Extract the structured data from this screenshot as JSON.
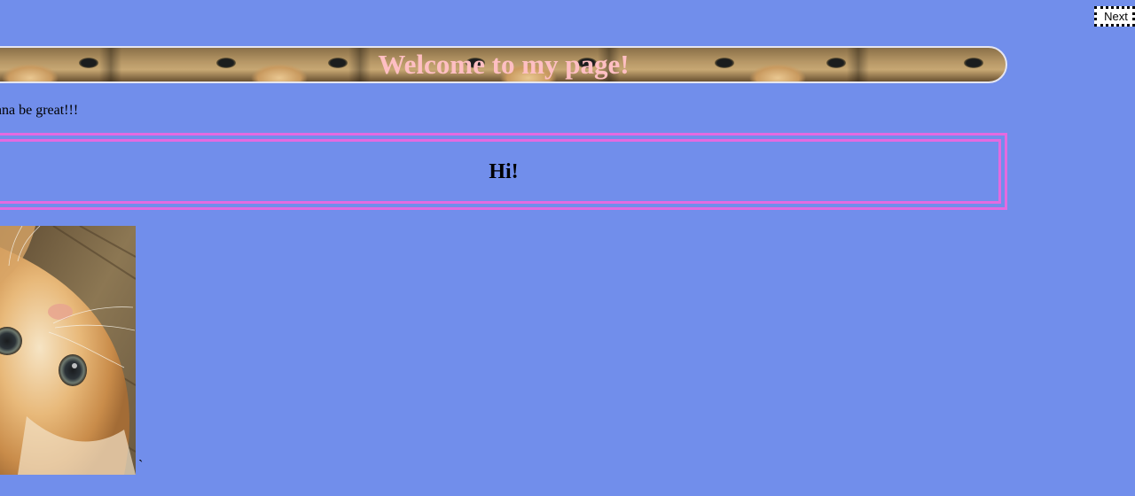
{
  "nav": {
    "next_label": "Next"
  },
  "banner": {
    "title": "Welcome to my page!"
  },
  "intro": {
    "text": "nna be great!!!"
  },
  "hi_box": {
    "title": "Hi!"
  },
  "stray": {
    "text": "`"
  },
  "colors": {
    "background": "#718eeb",
    "banner_title": "#ffbfc3",
    "box_border": "#e46ae0"
  },
  "images": {
    "banner_pattern": "kitten-eyes-pattern",
    "photo": "kitten-lying-upside-down"
  }
}
